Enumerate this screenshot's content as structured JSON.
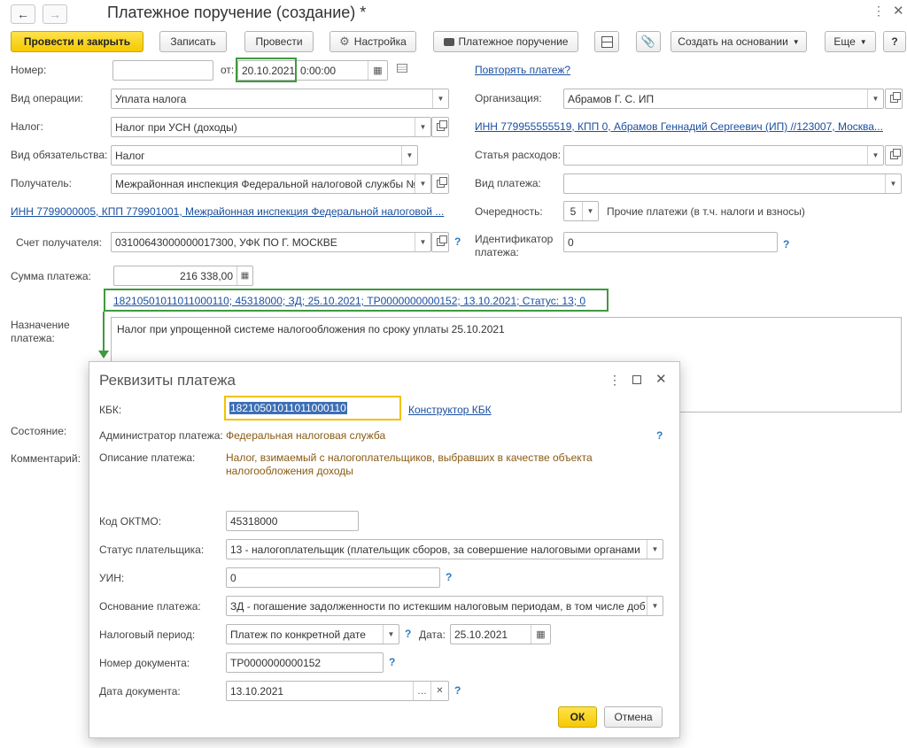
{
  "window": {
    "title": "Платежное поручение (создание) *"
  },
  "toolbar": {
    "post_close": "Провести и закрыть",
    "save": "Записать",
    "post": "Провести",
    "settings": "Настройка",
    "print": "Платежное поручение",
    "create_based": "Создать на основании",
    "more": "Еще",
    "help": "?"
  },
  "form": {
    "number_label": "Номер:",
    "number_value": "",
    "from_label": "от:",
    "date_value": "20.10.2021",
    "time_value": "0:00:00",
    "repeat_link": "Повторять платеж?",
    "operation_label": "Вид операции:",
    "operation_value": "Уплата налога",
    "org_label": "Организация:",
    "org_value": "Абрамов Г. С. ИП",
    "tax_label": "Налог:",
    "tax_value": "Налог при УСН (доходы)",
    "org_inn_link": "ИНН 779955555519, КПП 0, Абрамов Геннадий Сергеевич (ИП) //123007, Москва...",
    "obligation_label": "Вид обязательства:",
    "obligation_value": "Налог",
    "expense_label": "Статья расходов:",
    "expense_value": "",
    "recipient_label": "Получатель:",
    "recipient_value": "Межрайонная инспекция Федеральной налоговой службы №",
    "payment_kind_label": "Вид платежа:",
    "payment_kind_value": "",
    "recipient_inn_link": "ИНН 7799000005, КПП 779901001, Межрайонная инспекция Федеральной налоговой ...",
    "priority_label": "Очередность:",
    "priority_value": "5",
    "priority_text": "Прочие платежи (в т.ч. налоги и взносы)",
    "account_label": "Счет получателя:",
    "account_value": "03100643000000017300, УФК ПО Г. МОСКВЕ",
    "identifier_label_1": "Идентификатор",
    "identifier_label_2": "платежа:",
    "identifier_value": "0",
    "sum_label": "Сумма платежа:",
    "sum_value": "216 338,00",
    "requisites_link": "18210501011011000110; 45318000; ЗД; 25.10.2021; ТР0000000000152; 13.10.2021; Статус: 13; 0",
    "purpose_label_1": "Назначение",
    "purpose_label_2": "платежа:",
    "purpose_value": "Налог при упрощенной системе налогообложения по сроку уплаты 25.10.2021",
    "state_label": "Состояние:",
    "comment_label": "Комментарий:"
  },
  "dialog": {
    "title": "Реквизиты платежа",
    "kbk_label": "КБК:",
    "kbk_value": "18210501011011000110",
    "kbk_link": "Конструктор КБК",
    "admin_label": "Администратор платежа:",
    "admin_value": "Федеральная налоговая служба",
    "desc_label": "Описание платежа:",
    "desc_line1": "Налог, взимаемый с налогоплательщиков, выбравших в качестве объекта",
    "desc_line2": "налогообложения доходы",
    "oktmo_label": "Код ОКТМО:",
    "oktmo_value": "45318000",
    "status_label": "Статус плательщика:",
    "status_value": "13 - налогоплательщик (плательщик сборов, за совершение налоговыми органами",
    "uin_label": "УИН:",
    "uin_value": "0",
    "basis_label": "Основание платежа:",
    "basis_value": "ЗД - погашение задолженности по истекшим налоговым периодам, в том числе доб",
    "period_label": "Налоговый период:",
    "period_value": "Платеж по конкретной дате",
    "date_label": "Дата:",
    "date_value": "25.10.2021",
    "docnum_label": "Номер документа:",
    "docnum_value": "ТР0000000000152",
    "docdate_label": "Дата документа:",
    "docdate_value": "13.10.2021",
    "ok": "ОК",
    "cancel": "Отмена"
  },
  "colors": {
    "accent_yellow": "#f5c800",
    "highlight_green": "#3f9a3f",
    "link_blue": "#1a4fa0",
    "help_blue": "#2a7bc0"
  }
}
